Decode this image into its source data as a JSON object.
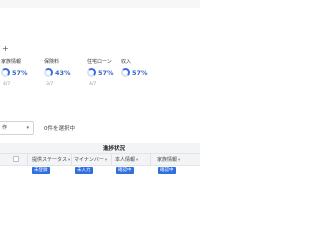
{
  "header": {
    "plus_icon": "plus-icon"
  },
  "progress_cards": [
    {
      "label": "家族情報",
      "percent": "57%",
      "count": "4/7",
      "value": 0.57
    },
    {
      "label": "保険料",
      "percent": "43%",
      "count": "3/7",
      "value": 0.43
    },
    {
      "label": "住宅ローン",
      "percent": "57%",
      "count": "4/7",
      "value": 0.57
    },
    {
      "label": "収入",
      "percent": "57%",
      "count": "",
      "value": 0.57
    }
  ],
  "toolbar": {
    "action_label": "作",
    "action_icon": "chevron-down-icon",
    "selected_count": "0件を選択中"
  },
  "table": {
    "group_label": "進捗状況",
    "columns": [
      {
        "label": "提供ステータス",
        "filter_icon": "filter-icon"
      },
      {
        "label": "マイナンバー",
        "filter_icon": "filter-icon"
      },
      {
        "label": "本人情報",
        "filter_icon": "filter-icon"
      },
      {
        "label": "家族情報",
        "filter_icon": "filter-icon"
      }
    ],
    "rows": [
      {
        "badges": [
          {
            "label": "未登録",
            "color": "#2f6fe0"
          },
          {
            "label": "未入力",
            "color": "#2f6fe0"
          },
          {
            "label": "確認中",
            "color": "#2f6fe0"
          },
          {
            "label": "確認中",
            "color": "#2f6fe0"
          }
        ]
      }
    ]
  },
  "colors": {
    "accent": "#3e6de0",
    "ring_track": "#d7e2fb",
    "percent_text": "#3766c6"
  }
}
